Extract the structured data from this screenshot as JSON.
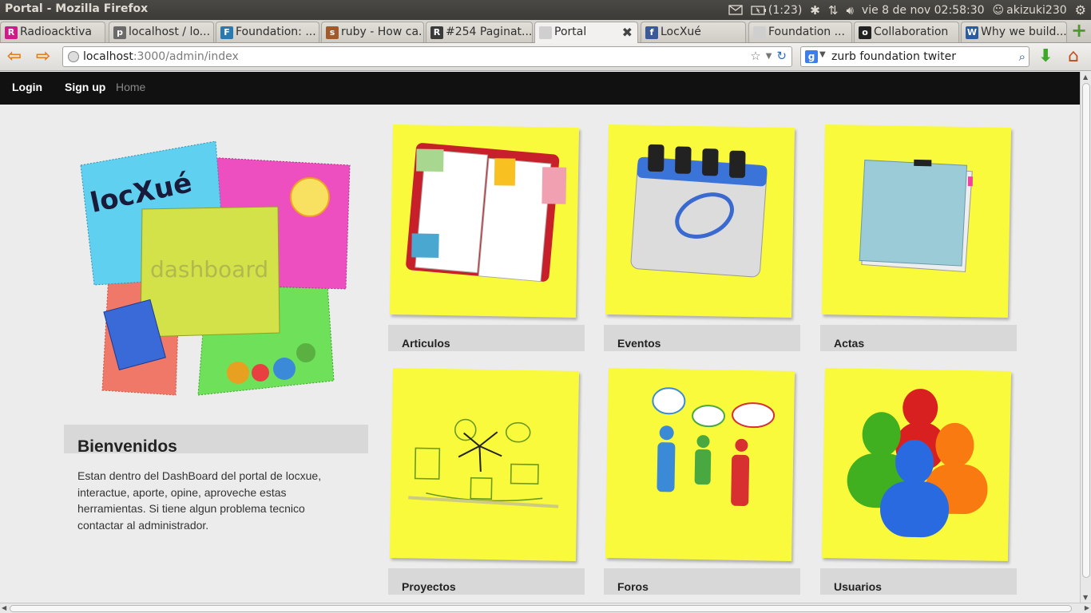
{
  "os_panel": {
    "window_title": "Portal - Mozilla Firefox",
    "battery": "(1:23)",
    "clock": "vie  8 de nov 02:58:30",
    "user": "akizuki230"
  },
  "tabs": [
    {
      "label": "Radioacktiva",
      "favicon": "R",
      "color": "#d01a8a"
    },
    {
      "label": "localhost / lo...",
      "favicon": "p",
      "color": "#6a6a6a"
    },
    {
      "label": "Foundation: ...",
      "favicon": "F",
      "color": "#2a7ab0"
    },
    {
      "label": "ruby - How ca...",
      "favicon": "s",
      "color": "#a05a2c"
    },
    {
      "label": "#254 Paginat...",
      "favicon": "R",
      "color": "#3a3a3a"
    },
    {
      "label": "Portal",
      "favicon": "",
      "color": "#cfcfcf"
    },
    {
      "label": "LocXué",
      "favicon": "f",
      "color": "#3b5998"
    },
    {
      "label": "Foundation ...",
      "favicon": "",
      "color": "#cfcfcf"
    },
    {
      "label": "Collaboration",
      "favicon": "o",
      "color": "#222"
    },
    {
      "label": "Why we build...",
      "favicon": "W",
      "color": "#2c5aa0"
    }
  ],
  "address": {
    "host": "localhost",
    "path": ":3000/admin/index"
  },
  "search": {
    "query": "zurb foundation twiter"
  },
  "topbar": {
    "login": "Login",
    "signup": "Sign up",
    "home": "Home"
  },
  "collage": {
    "logo_text": "locXué",
    "dashboard_text": "dashboard"
  },
  "welcome": {
    "title": "Bienvenidos",
    "text": "Estan dentro del DashBoard del portal de locxue, interactue, aporte, opine, aproveche estas herramientas. Si tiene algun problema tecnico contactar al administrador."
  },
  "tiles": [
    {
      "label": "Articulos",
      "icon": "notebook-icon"
    },
    {
      "label": "Eventos",
      "icon": "calendar-icon"
    },
    {
      "label": "Actas",
      "icon": "folder-icon"
    },
    {
      "label": "Proyectos",
      "icon": "sketch-flow-icon"
    },
    {
      "label": "Foros",
      "icon": "people-chat-icon"
    },
    {
      "label": "Usuarios",
      "icon": "users-icon"
    }
  ],
  "colors": {
    "sticky_yellow": "#fafa3c",
    "topbar_black": "#111111",
    "label_gray": "#d8d8d8"
  }
}
